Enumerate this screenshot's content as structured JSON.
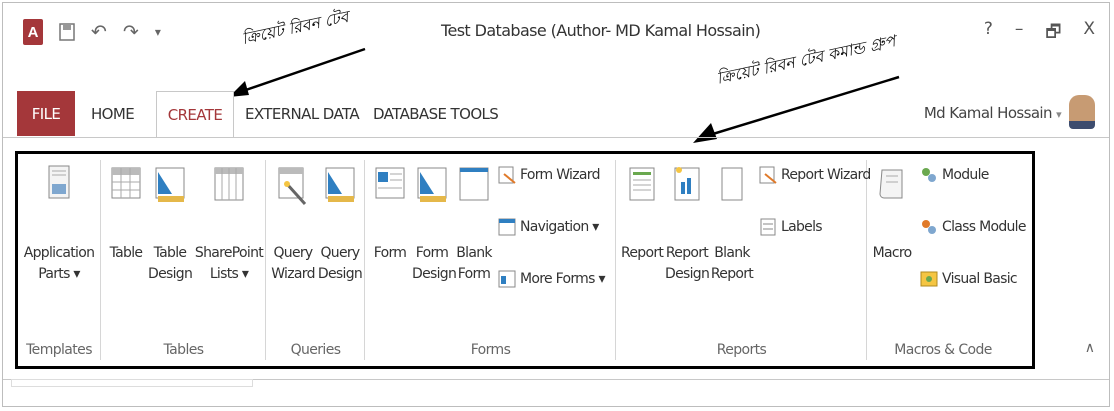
{
  "window": {
    "title": "Test Database (Author- MD Kamal Hossain)",
    "help": "?",
    "minimize": "–",
    "restore": "🗗",
    "close": "X"
  },
  "qat": {
    "logo": "A",
    "save_icon": "save-icon",
    "undo": "↶",
    "redo": "↷",
    "customize": "▾"
  },
  "annotations": {
    "ribbon_tab": "ক্রিয়েট রিবন টেব",
    "command_group": "ক্রিয়েট রিবন টেব কমান্ড গ্রুপ"
  },
  "tabs": [
    "FILE",
    "HOME",
    "CREATE",
    "EXTERNAL DATA",
    "DATABASE TOOLS"
  ],
  "user": {
    "name": "Md Kamal Hossain",
    "menu": "▾"
  },
  "groups": {
    "templates": {
      "label": "Templates",
      "app_parts": [
        "Application",
        "Parts ▾"
      ]
    },
    "tables": {
      "label": "Tables",
      "table": "Table",
      "table_design": [
        "Table",
        "Design"
      ],
      "sharepoint": [
        "SharePoint",
        "Lists ▾"
      ]
    },
    "queries": {
      "label": "Queries",
      "wizard": [
        "Query",
        "Wizard"
      ],
      "design": [
        "Query",
        "Design"
      ]
    },
    "forms": {
      "label": "Forms",
      "form": "Form",
      "form_design": [
        "Form",
        "Design"
      ],
      "blank_form": [
        "Blank",
        "Form"
      ],
      "form_wizard": "Form Wizard",
      "navigation": "Navigation ▾",
      "more_forms": "More Forms ▾"
    },
    "reports": {
      "label": "Reports",
      "report": "Report",
      "report_design": [
        "Report",
        "Design"
      ],
      "blank_report": [
        "Blank",
        "Report"
      ],
      "report_wizard": "Report Wizard",
      "labels": "Labels"
    },
    "macros": {
      "label": "Macros & Code",
      "macro": "Macro",
      "module": "Module",
      "class_module": "Class Module",
      "visual_basic": "Visual Basic"
    }
  },
  "collapse": "∧",
  "colors": {
    "accent": "#a4373a"
  }
}
